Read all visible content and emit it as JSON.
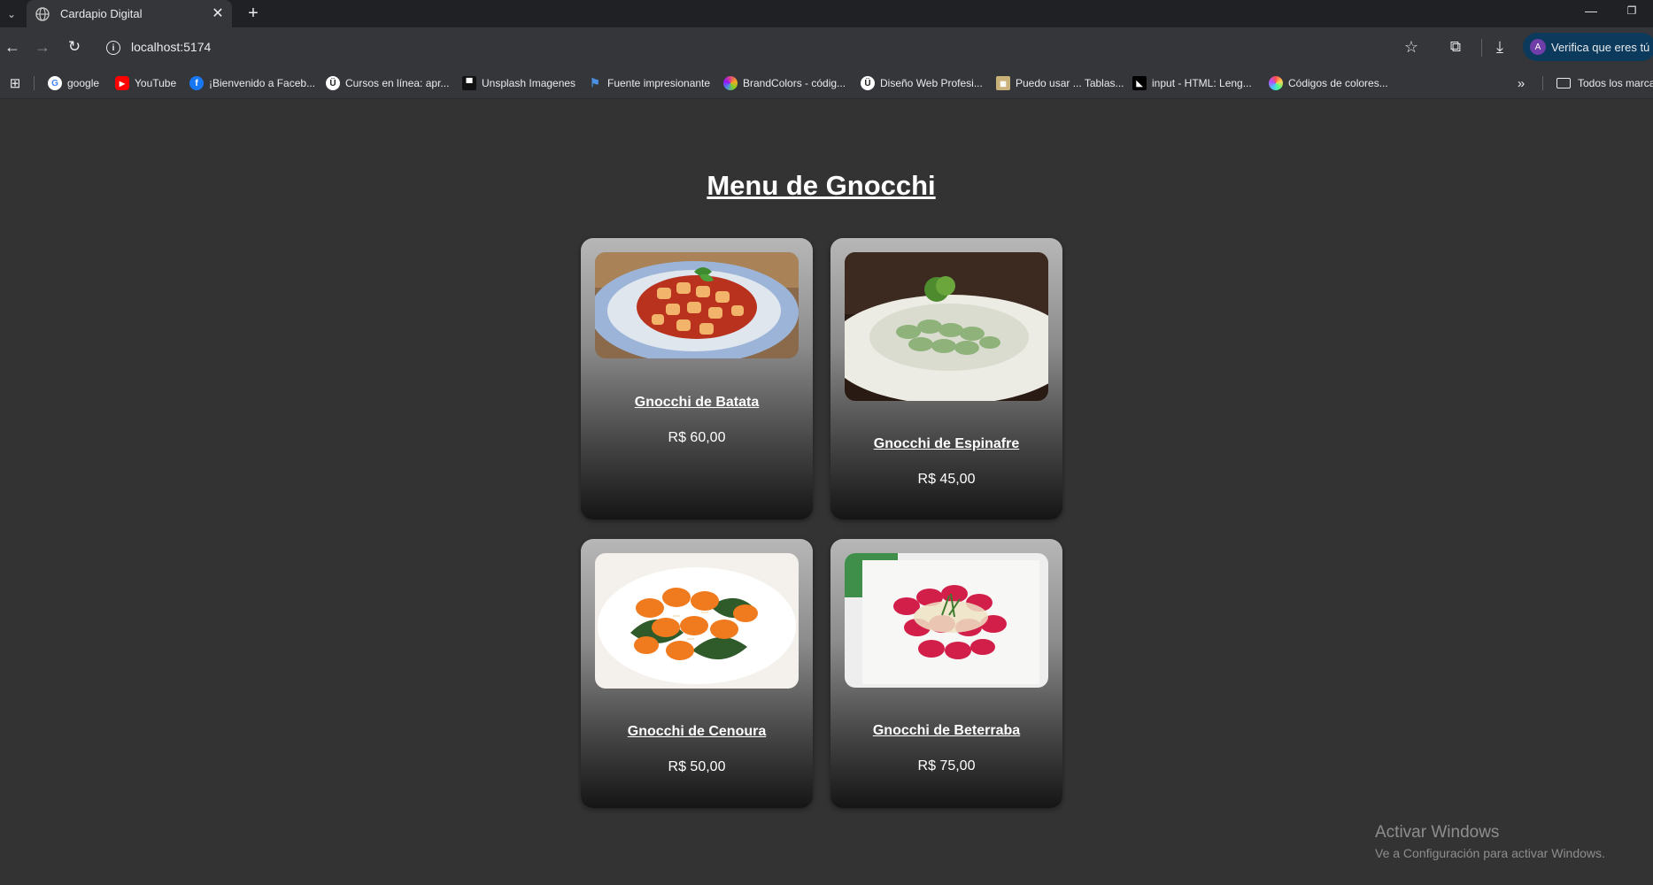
{
  "browser": {
    "tab_title": "Cardapio Digital",
    "address": "localhost:5174",
    "profile_label": "Verifica que eres tú",
    "profile_initial": "A",
    "bookmarks": [
      {
        "label": "google",
        "icon": "google-icon",
        "color": "#ffffff"
      },
      {
        "label": "YouTube",
        "icon": "youtube-icon",
        "color": "#ff0000"
      },
      {
        "label": "¡Bienvenido a Faceb...",
        "icon": "facebook-icon",
        "color": "#1877f2"
      },
      {
        "label": "Cursos en línea: apr...",
        "icon": "udemy-icon",
        "color": "#ffffff"
      },
      {
        "label": "Unsplash Imagenes",
        "icon": "unsplash-icon",
        "color": "#111111"
      },
      {
        "label": "Fuente impresionante",
        "icon": "flag-icon",
        "color": "#4a90e2"
      },
      {
        "label": "BrandColors - códig...",
        "icon": "brandcolors-icon",
        "color": "#e0457b"
      },
      {
        "label": "Diseño Web Profesi...",
        "icon": "udemy-icon",
        "color": "#ffffff"
      },
      {
        "label": "Puedo usar ... Tablas...",
        "icon": "caniuse-icon",
        "color": "#c8b27a"
      },
      {
        "label": "input - HTML: Leng...",
        "icon": "mdn-icon",
        "color": "#000000"
      },
      {
        "label": "Códigos de colores...",
        "icon": "colorwheel-icon",
        "color": "#ff4d4d"
      }
    ],
    "all_bookmarks_label": "Todos los marca"
  },
  "page": {
    "title": "Menu de Gnocchi",
    "items": [
      {
        "name": "Gnocchi de Batata",
        "price": "R$ 60,00",
        "image": "gnocchi-batata-photo"
      },
      {
        "name": "Gnocchi de Espinafre",
        "price": "R$ 45,00",
        "image": "gnocchi-espinafre-photo"
      },
      {
        "name": "Gnocchi de Cenoura",
        "price": "R$ 50,00",
        "image": "gnocchi-cenoura-photo"
      },
      {
        "name": "Gnocchi de Beterraba",
        "price": "R$ 75,00",
        "image": "gnocchi-beterraba-photo"
      }
    ]
  },
  "watermark": {
    "title": "Activar Windows",
    "subtitle": "Ve a Configuración para activar Windows."
  }
}
